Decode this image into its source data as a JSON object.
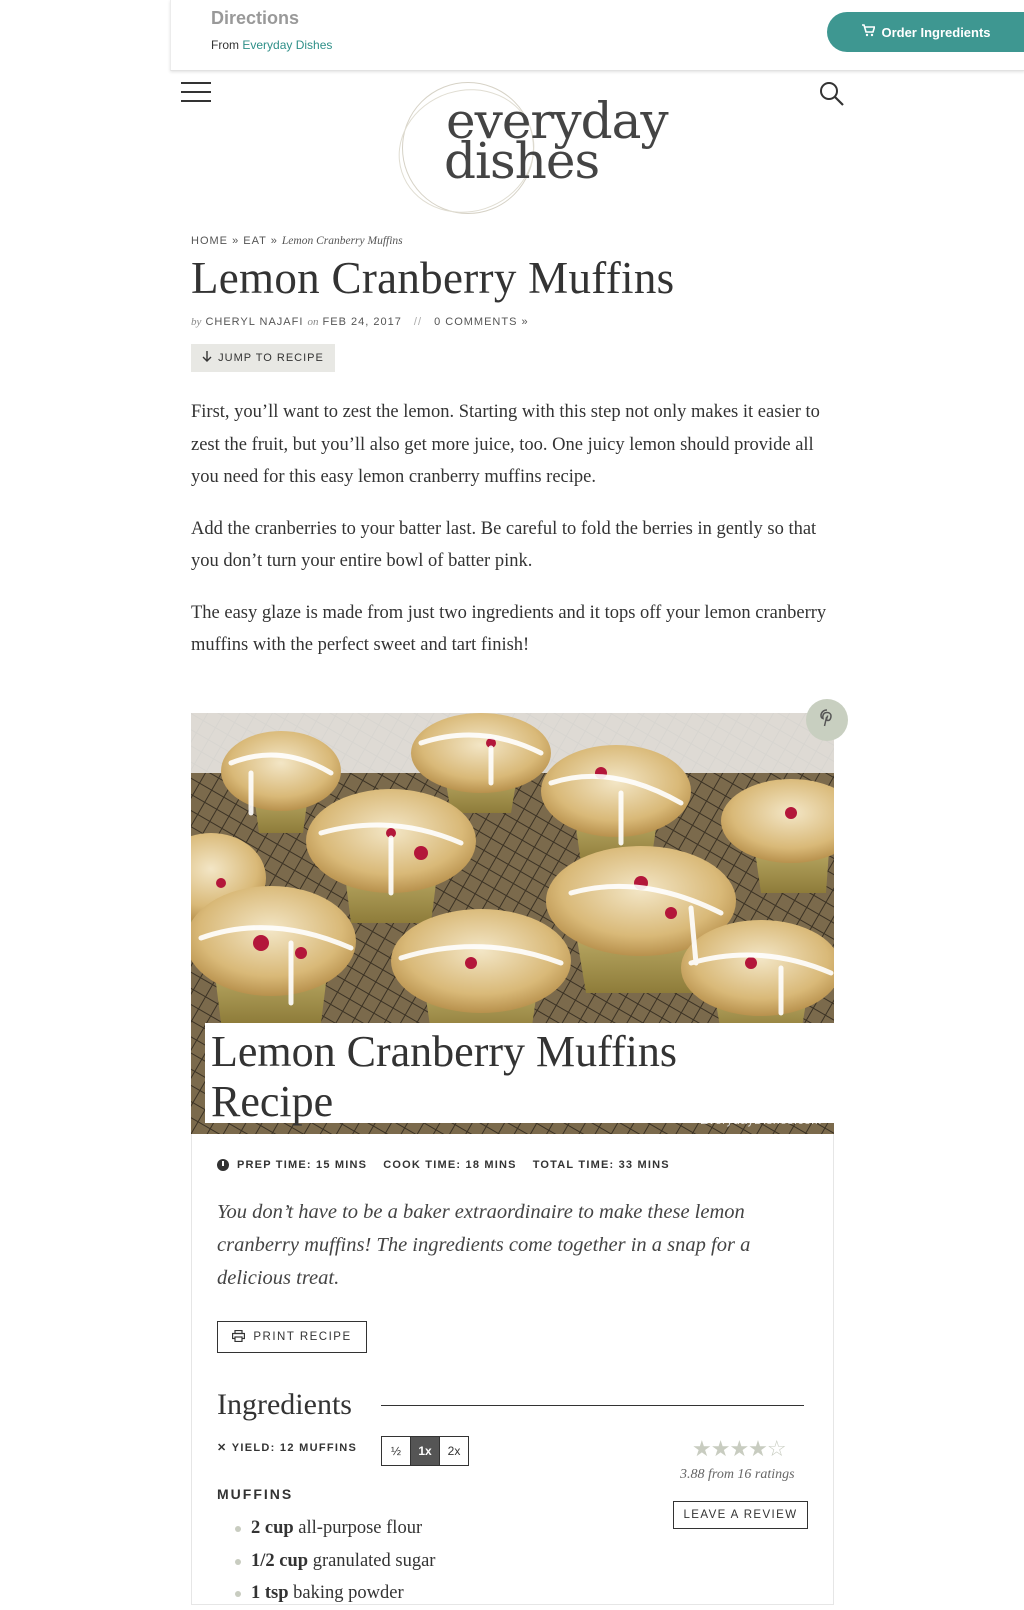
{
  "topbar": {
    "title": "Directions",
    "from_prefix": "From",
    "from_link": "Everyday Dishes",
    "order_button": "Order Ingredients"
  },
  "logo": {
    "line1": "everyday",
    "line2": "dishes"
  },
  "breadcrumb": {
    "home": "HOME",
    "sep1": "»",
    "eat": "EAT",
    "sep2": "»",
    "current": "Lemon Cranberry Muffins"
  },
  "article": {
    "title": "Lemon Cranberry Muffins",
    "by": "by",
    "author": "CHERYL NAJAFI",
    "on": "on",
    "date": "FEB 24, 2017",
    "divider": "//",
    "comments": "0 COMMENTS »",
    "jump": "JUMP TO RECIPE",
    "paragraphs": [
      "First, you’ll want to zest the lemon. Starting with this step not only makes it easier to zest the fruit, but you’ll also get more juice, too. One juicy lemon should provide all you need for this easy lemon cranberry muffins recipe.",
      "Add the cranberries to your batter last. Be careful to fold the berries in gently so that you don’t turn your entire bowl of batter pink.",
      "The easy glaze is made from just two ingredients and it tops off your lemon cranberry muffins with the perfect sweet and tart finish!"
    ]
  },
  "recipe": {
    "title_line1": "Lemon Cranberry Muffins",
    "title_line2": "Recipe",
    "watermark": "EverydayDishes.com",
    "prep_label": "PREP TIME:",
    "prep_value": "15 MINS",
    "cook_label": "COOK TIME:",
    "cook_value": "18 MINS",
    "total_label": "TOTAL TIME:",
    "total_value": "33 MINS",
    "summary": "You don’t have to be a baker extraordinaire to make these lemon cranberry muffins! The ingredients come together in a snap for a delicious treat.",
    "print": "PRINT RECIPE",
    "ingredients_heading": "Ingredients",
    "yield_label": "YIELD:",
    "yield_value": "12 MUFFINS",
    "scales": [
      "½",
      "1x",
      "2x"
    ],
    "stars": "★★★★☆",
    "rating_text": "3.88 from 16 ratings",
    "rating_value": 3.88,
    "review": "LEAVE A REVIEW",
    "section": "MUFFINS",
    "ingredients": [
      {
        "amount": "2 cup",
        "name": "all-purpose flour"
      },
      {
        "amount": "1/2 cup",
        "name": "granulated sugar"
      },
      {
        "amount": "1 tsp",
        "name": "baking powder"
      }
    ]
  },
  "colors": {
    "accent": "#3e9791",
    "link": "#2e8f88",
    "star": "#c8ccc0"
  }
}
